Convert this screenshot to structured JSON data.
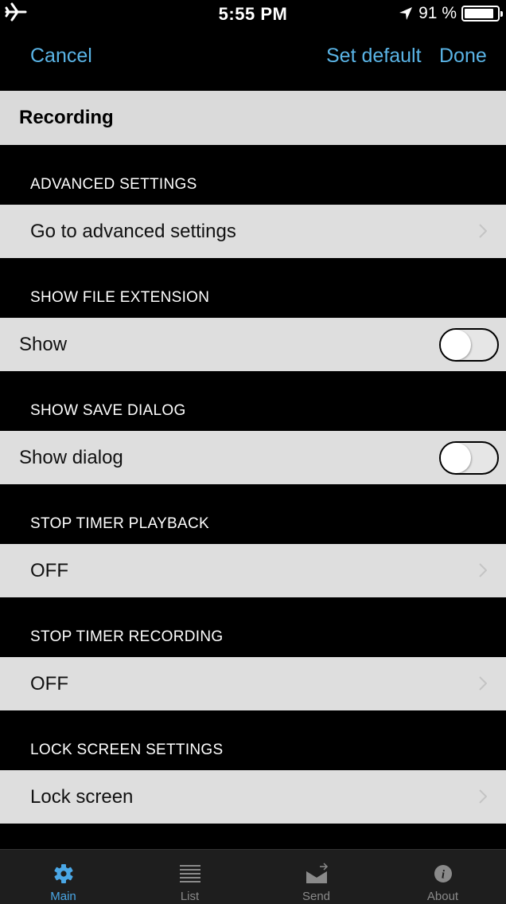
{
  "status_bar": {
    "time": "5:55 PM",
    "battery_text": "91 %",
    "battery_level": 0.91
  },
  "nav": {
    "cancel": "Cancel",
    "set_default": "Set default",
    "done": "Done"
  },
  "title": "Recording",
  "sections": [
    {
      "header": "ADVANCED SETTINGS",
      "row": "Go to advanced settings"
    },
    {
      "header": "SHOW FILE EXTENSION",
      "row": "Show",
      "toggle_on": false
    },
    {
      "header": "SHOW SAVE DIALOG",
      "row": "Show dialog",
      "toggle_on": false
    },
    {
      "header": "STOP TIMER PLAYBACK",
      "row": "OFF"
    },
    {
      "header": "STOP TIMER RECORDING",
      "row": "OFF"
    },
    {
      "header": "LOCK SCREEN SETTINGS",
      "row": "Lock screen"
    }
  ],
  "tabs": [
    {
      "label": "Main",
      "icon": "gear-icon",
      "active": true
    },
    {
      "label": "List",
      "icon": "list-icon"
    },
    {
      "label": "Send",
      "icon": "envelope-icon"
    },
    {
      "label": "About",
      "icon": "info-icon"
    }
  ],
  "colors": {
    "accent": "#5ab4e6",
    "row_bg": "#dedede",
    "header_bg": "#000000"
  }
}
